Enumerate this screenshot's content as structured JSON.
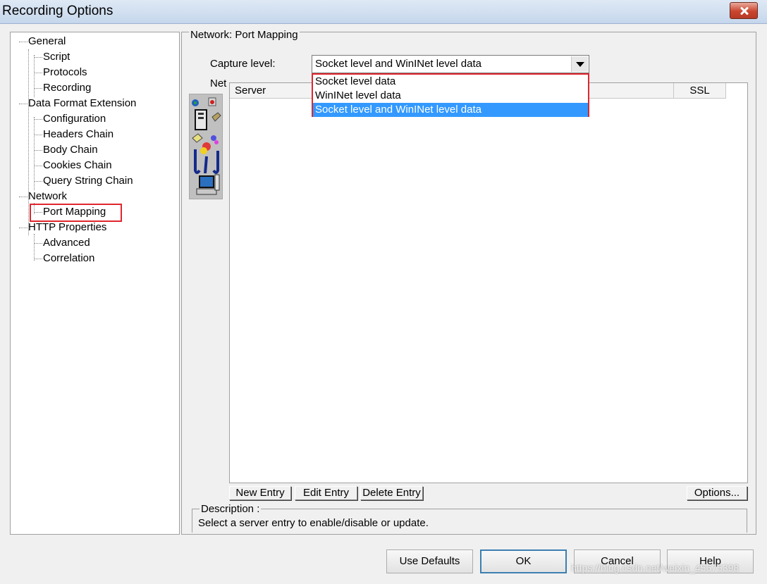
{
  "window": {
    "title": "Recording Options"
  },
  "tree": {
    "items": [
      {
        "label": "General"
      },
      {
        "label": "Script"
      },
      {
        "label": "Protocols"
      },
      {
        "label": "Recording"
      },
      {
        "label": "Data Format Extension"
      },
      {
        "label": "Configuration"
      },
      {
        "label": "Headers Chain"
      },
      {
        "label": "Body Chain"
      },
      {
        "label": "Cookies Chain"
      },
      {
        "label": "Query String Chain"
      },
      {
        "label": "Network"
      },
      {
        "label": "Port Mapping"
      },
      {
        "label": "HTTP Properties"
      },
      {
        "label": "Advanced"
      },
      {
        "label": "Correlation"
      }
    ],
    "selected": "Port Mapping"
  },
  "panel": {
    "group_title": "Network: Port Mapping",
    "capture_label": "Capture level:",
    "capture_value": "Socket level and WinINet level data",
    "capture_options": [
      "Socket level data",
      "WinINet level data",
      "Socket level and WinINet level data"
    ],
    "network_label": "Net",
    "columns": [
      "Server",
      "SSL"
    ],
    "buttons": {
      "new": "New Entry",
      "edit": "Edit Entry",
      "delete": "Delete Entry",
      "options": "Options..."
    },
    "description_label": "Description :",
    "description_text": "Select a server entry to enable/disable or update."
  },
  "footer": {
    "use_defaults": "Use Defaults",
    "ok": "OK",
    "cancel": "Cancel",
    "help": "Help"
  },
  "watermark": "https://blog.csdn.net/weixin_45675398",
  "colors": {
    "highlight": "#e0262d",
    "selection": "#3399ff"
  }
}
